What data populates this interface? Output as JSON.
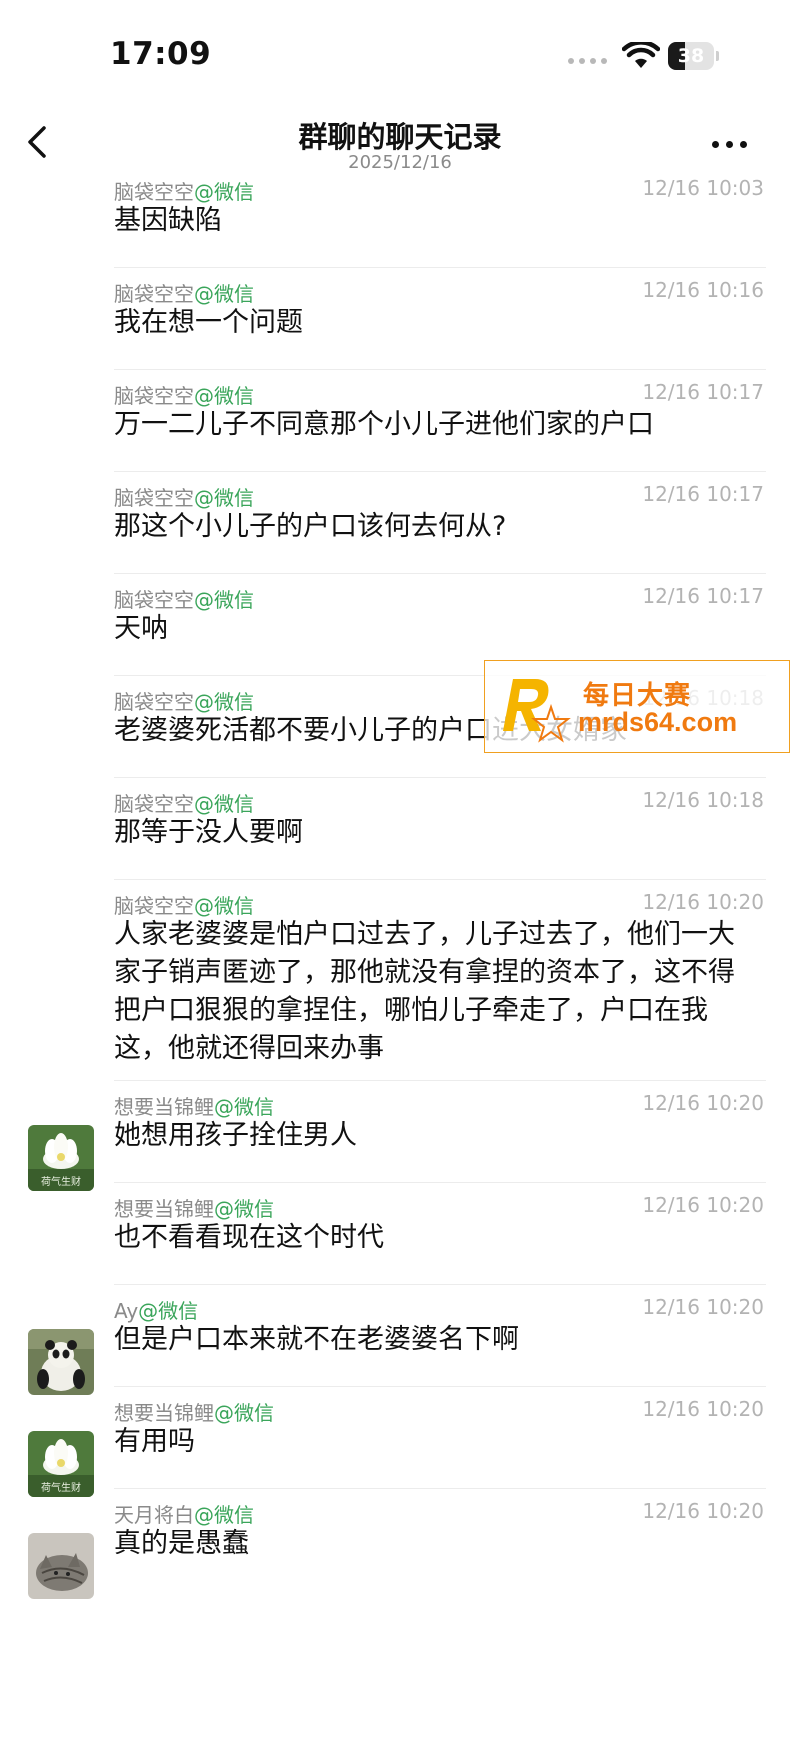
{
  "status_bar": {
    "time": "17:09",
    "battery": "38",
    "battery_level": 0.38
  },
  "header": {
    "title": "群聊的聊天记录",
    "date": "2025/12/16"
  },
  "watermark": {
    "title": "每日大赛",
    "url": "mrds64.com"
  },
  "messages": [
    {
      "sender": "脑袋空空",
      "app": "@微信",
      "time": "12/16 10:03",
      "text": "基因缺陷",
      "avatar": ""
    },
    {
      "sender": "脑袋空空",
      "app": "@微信",
      "time": "12/16 10:16",
      "text": "我在想一个问题",
      "avatar": ""
    },
    {
      "sender": "脑袋空空",
      "app": "@微信",
      "time": "12/16 10:17",
      "text": "万一二儿子不同意那个小儿子进他们家的户口",
      "avatar": ""
    },
    {
      "sender": "脑袋空空",
      "app": "@微信",
      "time": "12/16 10:17",
      "text": "那这个小儿子的户口该何去何从?",
      "avatar": ""
    },
    {
      "sender": "脑袋空空",
      "app": "@微信",
      "time": "12/16 10:17",
      "text": "天呐",
      "avatar": ""
    },
    {
      "sender": "脑袋空空",
      "app": "@微信",
      "time": "12/16 10:18",
      "text": "老婆婆死活都不要小儿子的户口进大女婿家",
      "avatar": ""
    },
    {
      "sender": "脑袋空空",
      "app": "@微信",
      "time": "12/16 10:18",
      "text": "那等于没人要啊",
      "avatar": ""
    },
    {
      "sender": "脑袋空空",
      "app": "@微信",
      "time": "12/16 10:20",
      "text": "人家老婆婆是怕户口过去了，儿子过去了，他们一大家子销声匿迹了，那他就没有拿捏的资本了，这不得把户口狠狠的拿捏住，哪怕儿子牵走了，户口在我这，他就还得回来办事",
      "avatar": ""
    },
    {
      "sender": "想要当锦鲤",
      "app": "@微信",
      "time": "12/16 10:20",
      "text": "她想用孩子拴住男人",
      "avatar": "lotus",
      "avatar_caption": "荷气生财"
    },
    {
      "sender": "想要当锦鲤",
      "app": "@微信",
      "time": "12/16 10:20",
      "text": "也不看看现在这个时代",
      "avatar": ""
    },
    {
      "sender": "Ay",
      "app": "@微信",
      "time": "12/16 10:20",
      "text": "但是户口本来就不在老婆婆名下啊",
      "avatar": "panda"
    },
    {
      "sender": "想要当锦鲤",
      "app": "@微信",
      "time": "12/16 10:20",
      "text": "有用吗",
      "avatar": "lotus",
      "avatar_caption": "荷气生财"
    },
    {
      "sender": "天月将白",
      "app": "@微信",
      "time": "12/16 10:20",
      "text": "真的是愚蠢",
      "avatar": "cat"
    }
  ]
}
